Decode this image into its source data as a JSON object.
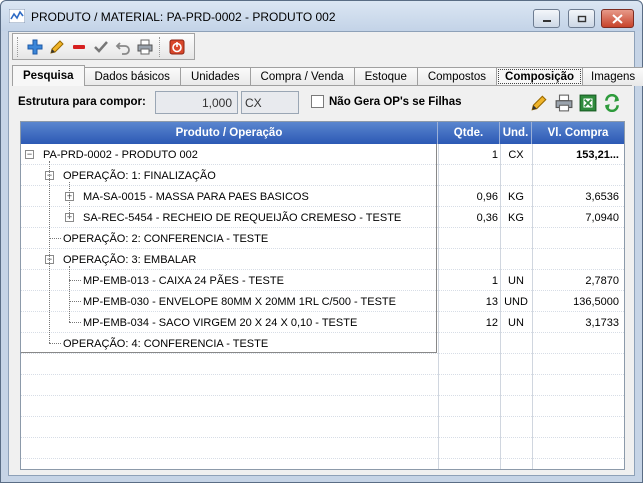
{
  "window": {
    "title": "PRODUTO / MATERIAL: PA-PRD-0002 - PRODUTO 002"
  },
  "toolbar": {
    "icons": [
      "add-icon",
      "edit-icon",
      "remove-icon",
      "confirm-icon",
      "undo-icon",
      "print-icon",
      "exit-icon"
    ]
  },
  "tabs": [
    {
      "label": "Pesquisa",
      "active": true
    },
    {
      "label": "Dados básicos"
    },
    {
      "label": "Unidades"
    },
    {
      "label": "Compra / Venda"
    },
    {
      "label": "Estoque"
    },
    {
      "label": "Compostos"
    },
    {
      "label": "Composição",
      "selected": true
    },
    {
      "label": "Imagens"
    }
  ],
  "structure": {
    "label": "Estrutura para compor:",
    "quantity": "1,000",
    "unit": "CX",
    "checkbox_label": "Não Gera OP's se Filhas",
    "checked": false
  },
  "grid": {
    "headers": {
      "product": "Produto / Operação",
      "qty": "Qtde.",
      "unit": "Und.",
      "price": "Vl. Compra"
    },
    "rows": [
      {
        "label": "PA-PRD-0002 - PRODUTO 002",
        "qty": "1",
        "unit": "CX",
        "price": "153,21...",
        "level": 0,
        "expander": "minus"
      },
      {
        "label": "OPERAÇÃO: 1: FINALIZAÇÃO",
        "qty": "",
        "unit": "",
        "price": "",
        "level": 1,
        "expander": "minus"
      },
      {
        "label": "MA-SA-0015 - MASSA PARA PAES BASICOS",
        "qty": "0,96",
        "unit": "KG",
        "price": "3,6536",
        "level": 2,
        "expander": "plus"
      },
      {
        "label": "SA-REC-5454 - RECHEIO DE REQUEIJÃO CREMESO - TESTE",
        "qty": "0,36",
        "unit": "KG",
        "price": "7,0940",
        "level": 2,
        "expander": "plus"
      },
      {
        "label": "OPERAÇÃO: 2: CONFERENCIA - TESTE",
        "qty": "",
        "unit": "",
        "price": "",
        "level": 1,
        "expander": "none"
      },
      {
        "label": "OPERAÇÃO: 3: EMBALAR",
        "qty": "",
        "unit": "",
        "price": "",
        "level": 1,
        "expander": "minus"
      },
      {
        "label": "MP-EMB-013 - CAIXA 24 PÃES - TESTE",
        "qty": "1",
        "unit": "UN",
        "price": "2,7870",
        "level": 2,
        "expander": "none"
      },
      {
        "label": "MP-EMB-030 - ENVELOPE 80MM X 20MM 1RL C/500 - TESTE",
        "qty": "13",
        "unit": "UND",
        "price": "136,5000",
        "level": 2,
        "expander": "none"
      },
      {
        "label": "MP-EMB-034 - SACO VIRGEM 20 X 24 X 0,10 - TESTE",
        "qty": "12",
        "unit": "UN",
        "price": "3,1733",
        "level": 2,
        "expander": "none"
      },
      {
        "label": "OPERAÇÃO: 4: CONFERENCIA - TESTE",
        "qty": "",
        "unit": "",
        "price": "",
        "level": 1,
        "expander": "none"
      }
    ]
  },
  "colors": {
    "header_blue": "#2c59b4",
    "remove_red": "#d62020",
    "exit_red": "#d9472b"
  }
}
